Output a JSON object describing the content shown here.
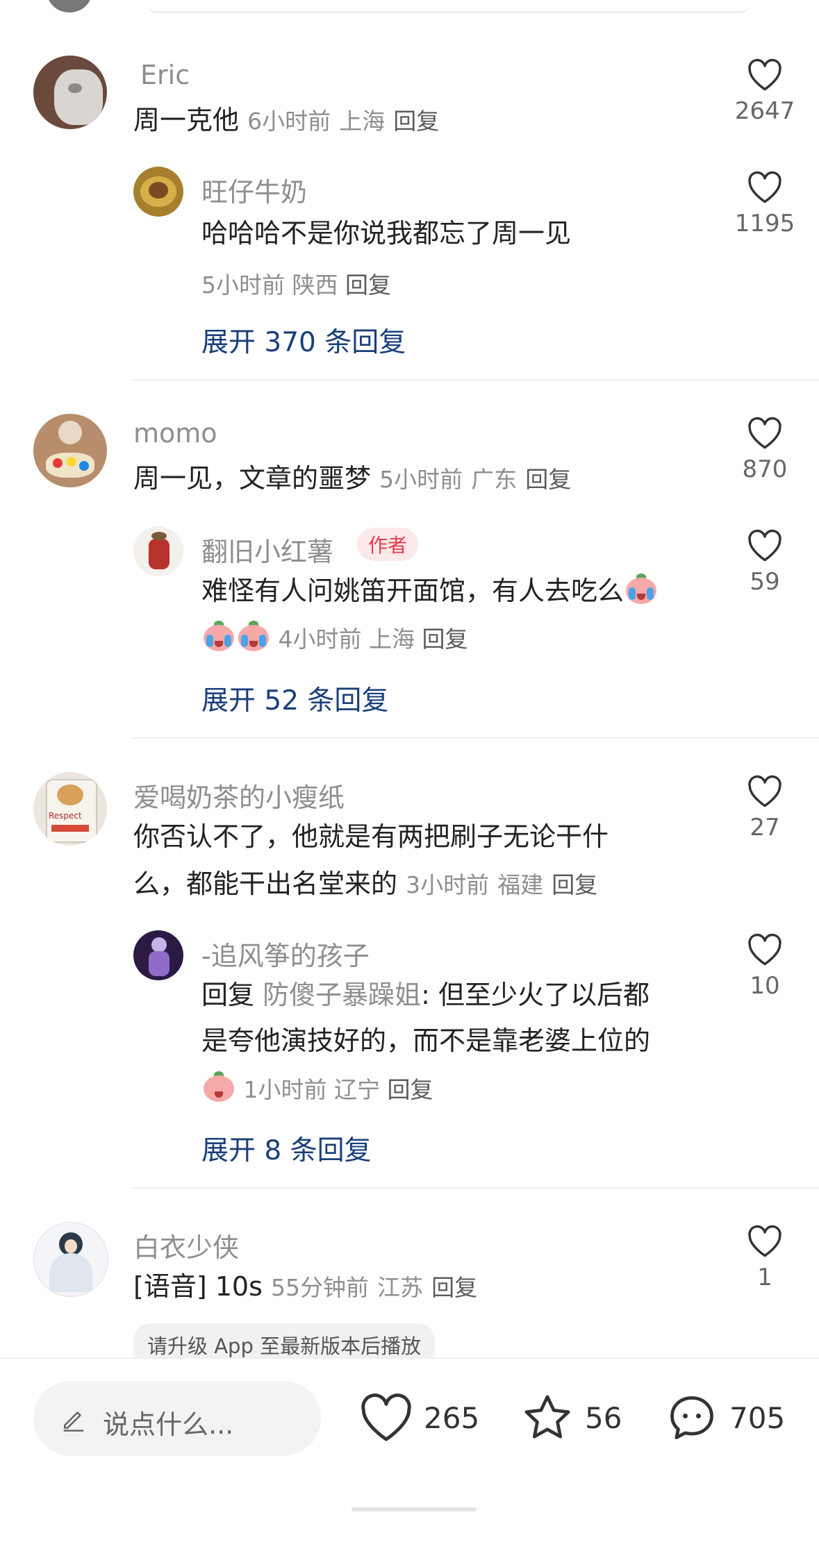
{
  "comments": [
    {
      "author": "Eric",
      "text": "周一克他",
      "time": "6小时前",
      "location": "上海",
      "reply_label": "回复",
      "likes": "2647",
      "reply": {
        "author": "旺仔牛奶",
        "text": "哈哈哈不是你说我都忘了周一见",
        "time": "5小时前",
        "location": "陕西",
        "reply_label": "回复",
        "likes": "1195"
      },
      "expand_label": "展开 370 条回复"
    },
    {
      "author": "momo",
      "text": "周一见，文章的噩梦",
      "time": "5小时前",
      "location": "广东",
      "reply_label": "回复",
      "likes": "870",
      "reply": {
        "author": "翻旧小红薯",
        "badge": "作者",
        "text": "难怪有人问姚笛开面馆，有人去吃么",
        "time": "4小时前",
        "location": "上海",
        "reply_label": "回复",
        "likes": "59"
      },
      "expand_label": "展开 52 条回复"
    },
    {
      "author": "爱喝奶茶的小瘦纸",
      "text_line1": "你否认不了，他就是有两把刷子无论干什",
      "text_line2": "么，都能干出名堂来的",
      "time": "3小时前",
      "location": "福建",
      "reply_label": "回复",
      "likes": "27",
      "avatar_text": "Respect",
      "reply": {
        "author": "-追风筝的孩子",
        "reply_prefix": "回复",
        "reply_target": "防傻子暴躁姐",
        "text_line1": ": 但至少火了以后都",
        "text_line2": "是夸他演技好的，而不是靠老婆上位的",
        "time": "1小时前",
        "location": "辽宁",
        "reply_label": "回复",
        "likes": "10"
      },
      "expand_label": "展开 8 条回复"
    },
    {
      "author": "白衣少侠",
      "text": "[语音] 10s",
      "time": "55分钟前",
      "location": "江苏",
      "reply_label": "回复",
      "likes": "1",
      "upgrade_hint": "请升级 App 至最新版本后播放"
    }
  ],
  "bottom_bar": {
    "input_placeholder": "说点什么...",
    "likes": "265",
    "favorites": "56",
    "comments": "705"
  },
  "colors": {
    "expand_link": "#1a3f78",
    "badge_text": "#e33b4a",
    "badge_bg": "#fde8ea",
    "meta_gray": "#8e8e8e"
  }
}
